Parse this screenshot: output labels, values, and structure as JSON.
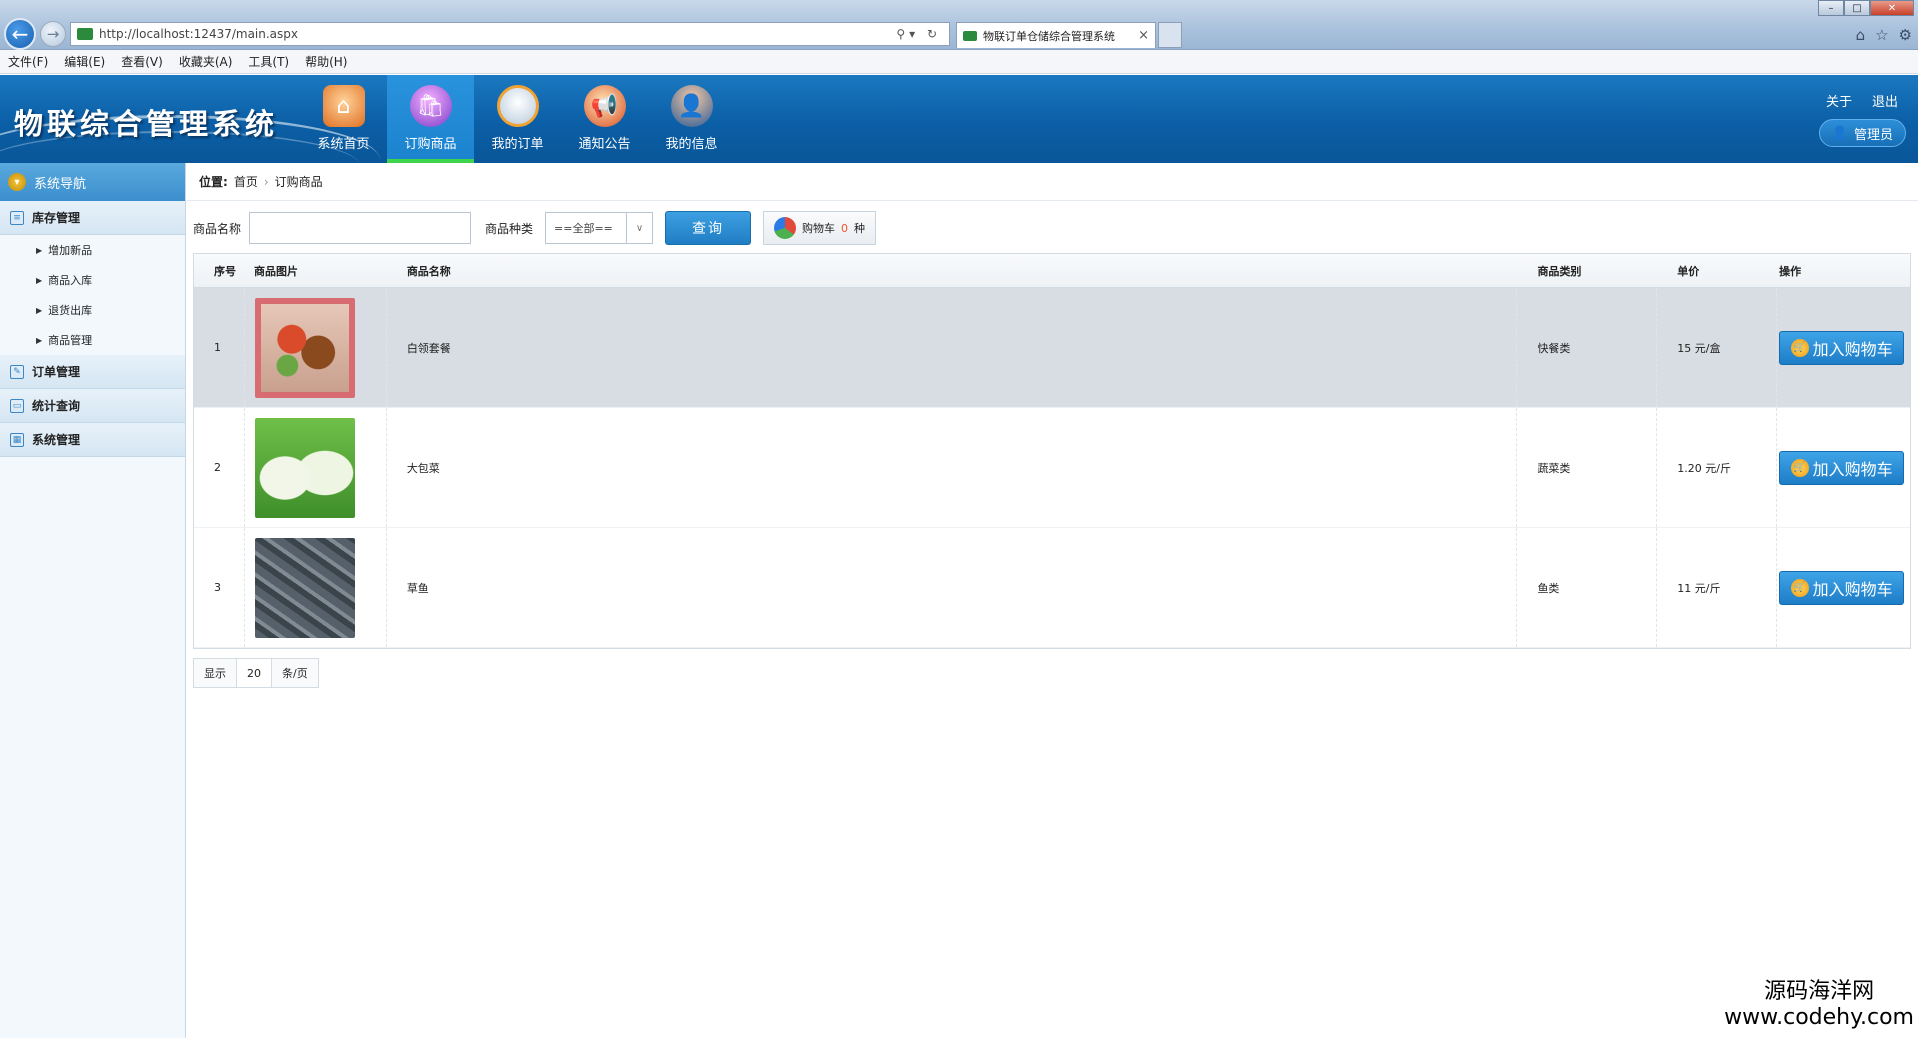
{
  "browser": {
    "url": "http://localhost:12437/main.aspx",
    "tab_title": "物联订单仓储综合管理系统",
    "tab_close": "×",
    "menu": [
      "文件(F)",
      "编辑(E)",
      "查看(V)",
      "收藏夹(A)",
      "工具(T)",
      "帮助(H)"
    ]
  },
  "header": {
    "app_title": "物联综合管理系统",
    "nav": [
      {
        "label": "系统首页",
        "icon": "home-icon",
        "active": false
      },
      {
        "label": "订购商品",
        "icon": "shopping-icon",
        "active": true
      },
      {
        "label": "我的订单",
        "icon": "orders-icon",
        "active": false
      },
      {
        "label": "通知公告",
        "icon": "megaphone-icon",
        "active": false
      },
      {
        "label": "我的信息",
        "icon": "user-icon",
        "active": false
      }
    ],
    "links": {
      "about": "关于",
      "logout": "退出"
    },
    "admin_label": "管理员"
  },
  "sidebar": {
    "title": "系统导航",
    "groups": [
      {
        "label": "库存管理",
        "items": [
          "增加新品",
          "商品入库",
          "退货出库",
          "商品管理"
        ]
      },
      {
        "label": "订单管理"
      },
      {
        "label": "统计查询"
      },
      {
        "label": "系统管理"
      }
    ]
  },
  "breadcrumb": {
    "label": "位置:",
    "home": "首页",
    "sep": "›",
    "current": "订购商品"
  },
  "search": {
    "name_label": "商品名称",
    "name_value": "",
    "type_label": "商品种类",
    "type_value": "==全部==",
    "query_button": "查询",
    "cart_label": "购物车",
    "cart_count": "0",
    "cart_unit": "种"
  },
  "table": {
    "headers": [
      "序号",
      "商品图片",
      "商品名称",
      "商品类别",
      "单价",
      "操作"
    ],
    "rows": [
      {
        "no": "1",
        "name": "白领套餐",
        "category": "快餐类",
        "price": "15 元/盒",
        "action": "加入购物车"
      },
      {
        "no": "2",
        "name": "大包菜",
        "category": "蔬菜类",
        "price": "1.20 元/斤",
        "action": "加入购物车"
      },
      {
        "no": "3",
        "name": "草鱼",
        "category": "鱼类",
        "price": "11 元/斤",
        "action": "加入购物车"
      }
    ]
  },
  "pager": {
    "show": "显示",
    "size": "20",
    "unit": "条/页"
  },
  "watermark": {
    "cn": "源码海洋网",
    "url": "www.codehy.com"
  },
  "colors": {
    "header_blue": "#0b5fa6",
    "active_tab": "#1c83cf",
    "active_underline": "#3fd44e",
    "button_blue": "#1f7dc4"
  }
}
